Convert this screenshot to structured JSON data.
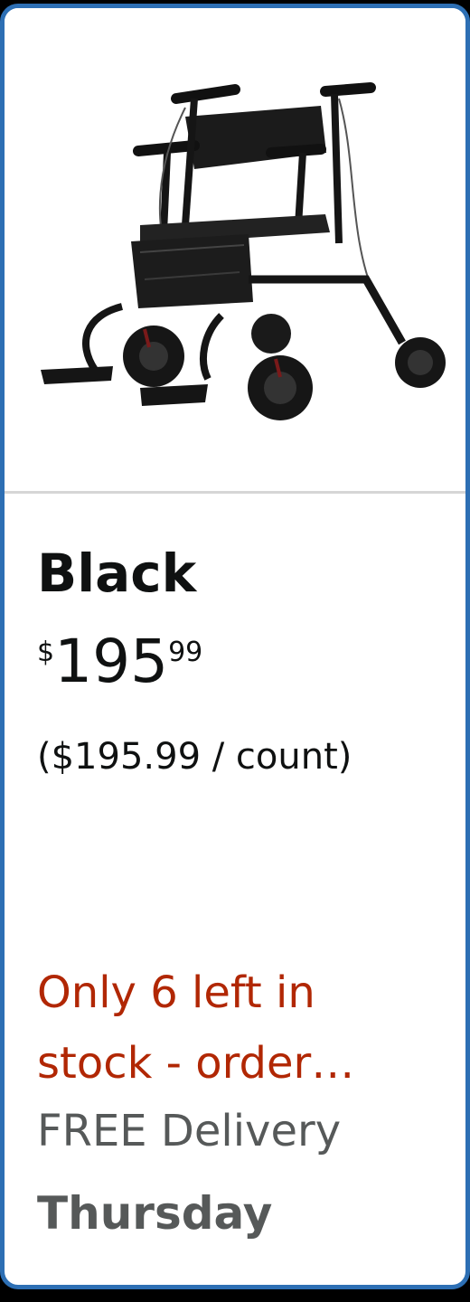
{
  "product": {
    "image_alt": "rollator-walker-product-image",
    "variant_name": "Black",
    "price_symbol": "$",
    "price_whole": "195",
    "price_fraction": "99",
    "unit_price": "($195.99 / count)",
    "stock_line1": "Only 6 left in",
    "stock_line2": "stock - order…",
    "delivery_label": "FREE Delivery",
    "delivery_day": "Thursday"
  },
  "colors": {
    "card_border": "#2d6fb4",
    "stock_red": "#b12704",
    "delivery_gray": "#565959",
    "text_dark": "#0f1111"
  }
}
